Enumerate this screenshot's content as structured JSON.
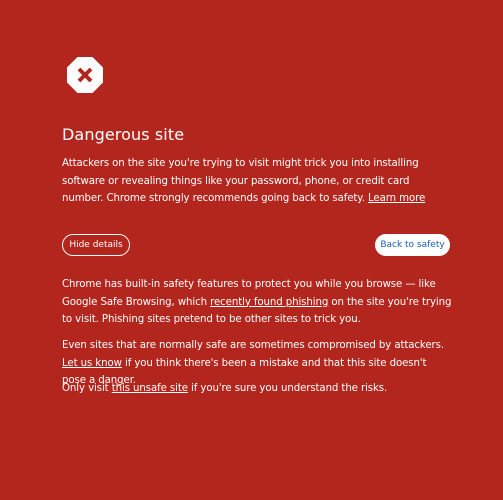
{
  "colors": {
    "background": "#b3261e",
    "text": "#ffffff",
    "primary_button_text": "#1a5fb4"
  },
  "icon": {
    "name": "danger-stop-icon"
  },
  "title": "Dangerous site",
  "intro": {
    "text": "Attackers on the site you're trying to visit might trick you into installing software or revealing things like your password, phone, or credit card number. Chrome strongly recommends going back to safety.",
    "learn_more": "Learn more"
  },
  "buttons": {
    "hide_details": "Hide details",
    "back_to_safety": "Back to safety"
  },
  "details": {
    "para1_before": "Chrome has built-in safety features to protect you while you browse — like Google Safe Browsing, which",
    "para1_link": "recently found phishing",
    "para1_after": "on the site you're trying to visit. Phishing sites pretend to be other sites to trick you.",
    "para2_before": "Even sites that are normally safe are sometimes compromised by attackers.",
    "para2_link": "Let us know",
    "para2_after": "if you think there's been a mistake and that this site doesn't pose a danger.",
    "para3_before": "Only visit",
    "para3_link": "this unsafe site",
    "para3_after": "if you're sure you understand the risks."
  }
}
